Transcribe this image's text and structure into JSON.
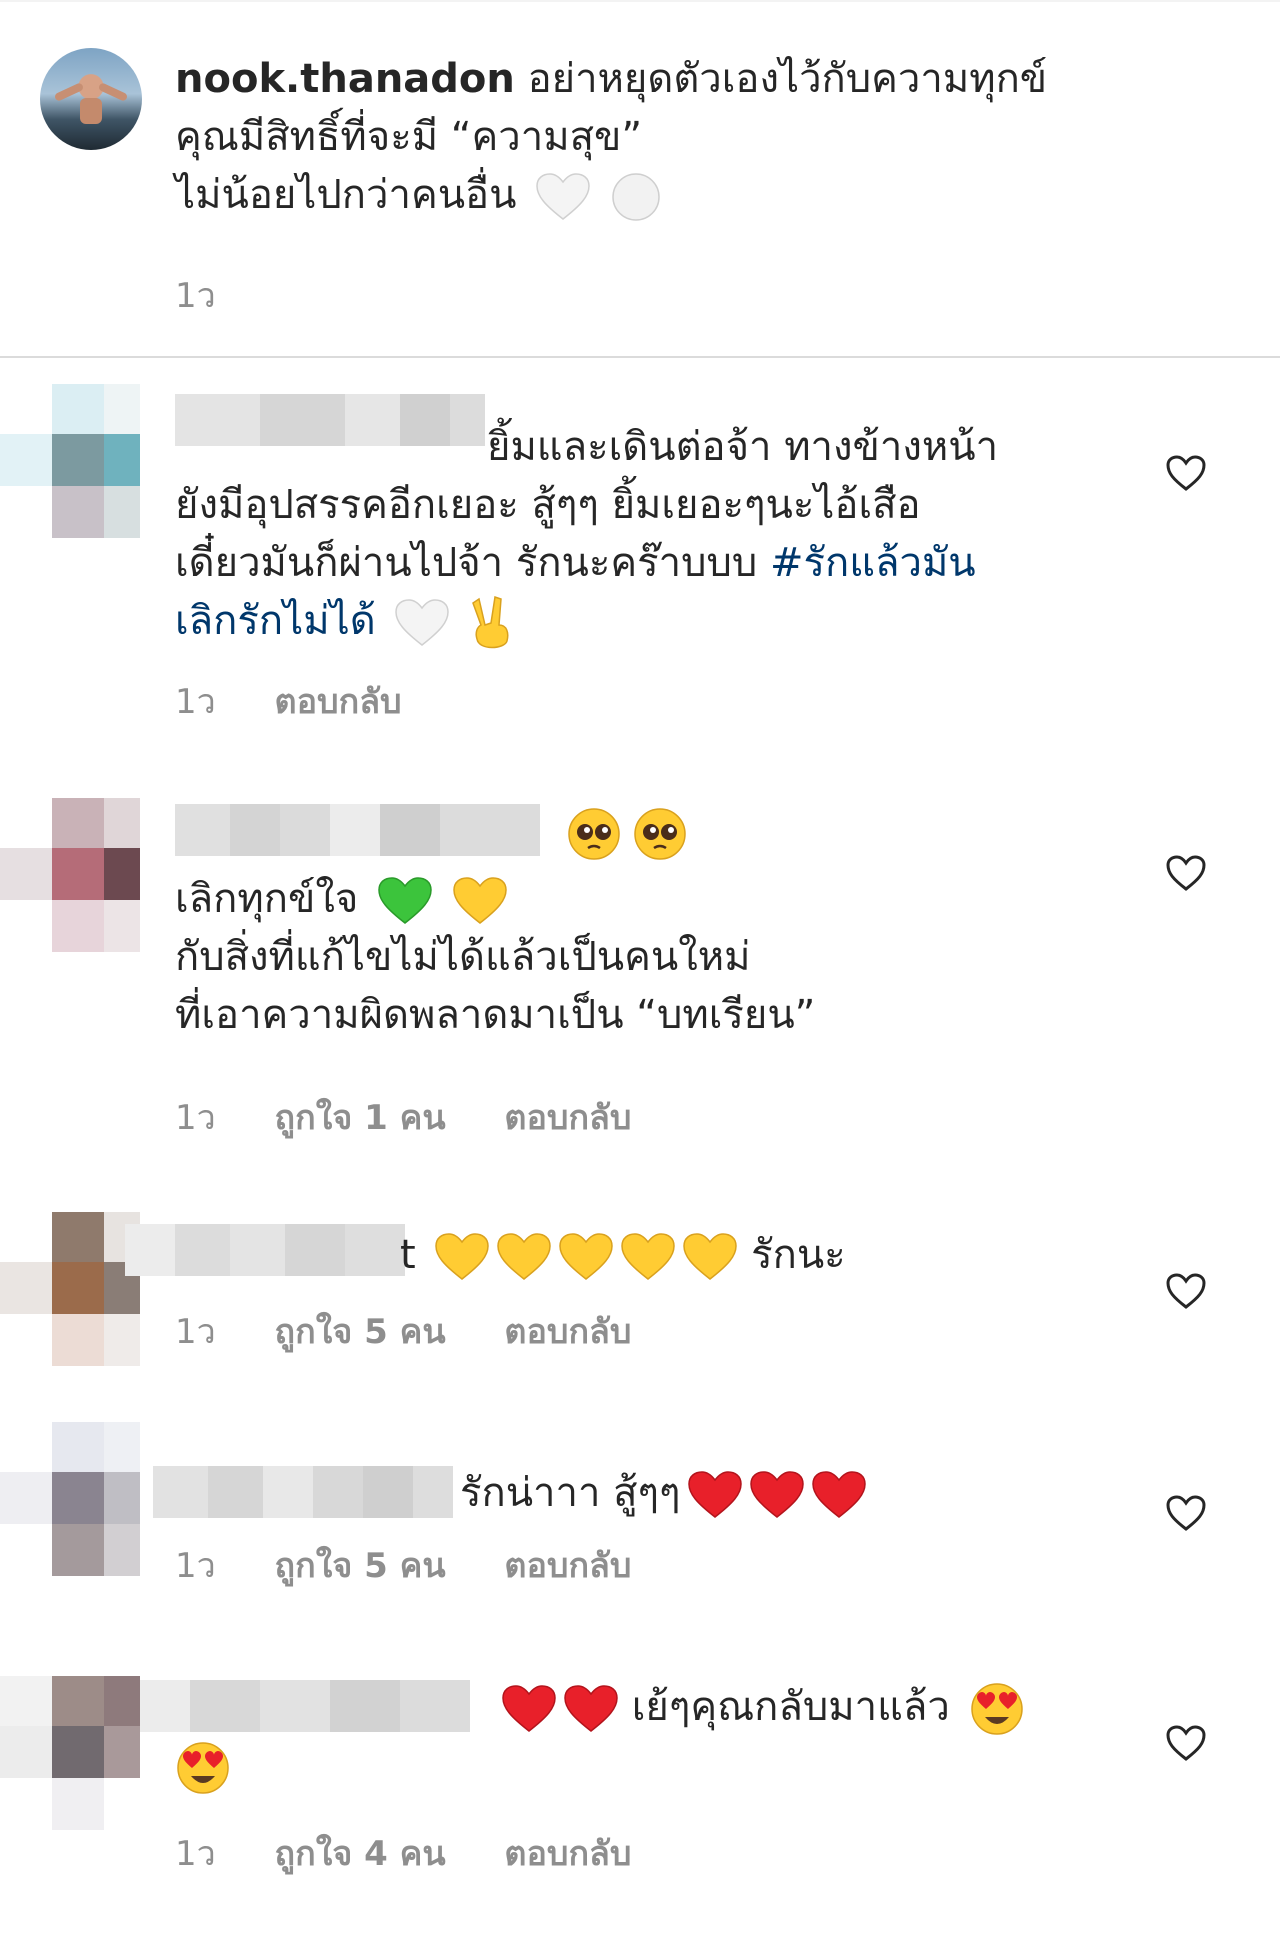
{
  "caption": {
    "username": "nook.thanadon",
    "lines": [
      "อย่าหยุดตัวเองไว้กับความทุกข์",
      "คุณมีสิทธิ์ที่จะมี “ความสุข”",
      "ไม่น้อยไปกว่าคนอื่น"
    ],
    "time": "1ว"
  },
  "comments": [
    {
      "lines": [
        "ยิ้มและเดินต่อจ้า ทางข้างหน้า",
        "ยังมีอุปสรรคอีกเยอะ สู้ๆๆ ยิ้มเยอะๆนะไอ้เสือ",
        "เดี๋ยวมันก็ผ่านไปจ้า รักนะคร๊าบบบ"
      ],
      "hashtag_part1": "#รักแล้วมัน",
      "hashtag_part2": "เลิกรักไม่ได้",
      "time": "1ว",
      "reply": "ตอบกลับ"
    },
    {
      "lines": [
        "เลิกทุกข์ใจ",
        "กับสิ่งที่แก้ไขไม่ได้แล้วเป็นคนใหม่",
        "ที่เอาความผิดพลาดมาเป็น “บทเรียน”"
      ],
      "time": "1ว",
      "likes": "ถูกใจ 1 คน",
      "reply": "ตอบกลับ"
    },
    {
      "text": "รักนะ",
      "name_tail": "t",
      "time": "1ว",
      "likes": "ถูกใจ 5 คน",
      "reply": "ตอบกลับ"
    },
    {
      "text": "รักน่าาา สู้ๆๆ",
      "time": "1ว",
      "likes": "ถูกใจ 5 คน",
      "reply": "ตอบกลับ"
    },
    {
      "text": "เย้ๆคุณกลับมาแล้ว",
      "time": "1ว",
      "likes": "ถูกใจ 4 คน",
      "reply": "ตอบกลับ"
    }
  ],
  "colors": {
    "text": "#262626",
    "meta": "#8e8e8e",
    "hashtag": "#00376b",
    "divider": "#dbdbdb"
  },
  "icons": [
    "heart-outline-icon",
    "white-heart-emoji",
    "white-circle-emoji",
    "victory-hand-emoji",
    "pleading-face-emoji",
    "green-heart-emoji",
    "yellow-heart-emoji",
    "red-heart-emoji",
    "heart-eyes-emoji"
  ]
}
